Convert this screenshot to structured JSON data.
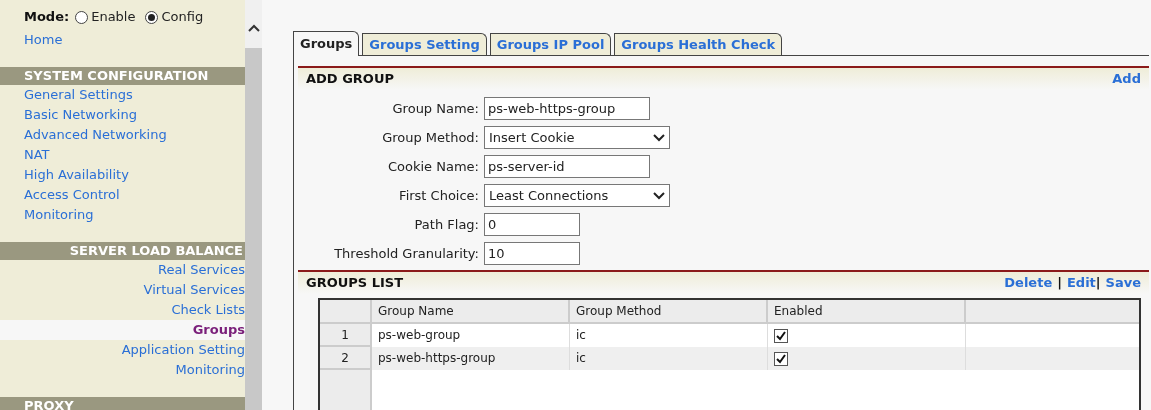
{
  "mode": {
    "label": "Mode:",
    "options": [
      {
        "label": "Enable",
        "selected": false
      },
      {
        "label": "Config",
        "selected": true
      }
    ]
  },
  "sidebar": {
    "home": "Home",
    "sections": [
      {
        "title": "SYSTEM CONFIGURATION",
        "items": [
          {
            "label": "General Settings",
            "selected": false
          },
          {
            "label": "Basic Networking",
            "selected": false
          },
          {
            "label": "Advanced Networking",
            "selected": false
          },
          {
            "label": "NAT",
            "selected": false
          },
          {
            "label": "High Availability",
            "selected": false
          },
          {
            "label": "Access Control",
            "selected": false
          },
          {
            "label": "Monitoring",
            "selected": false
          }
        ]
      },
      {
        "title": "SERVER LOAD BALANCE",
        "items": [
          {
            "label": "Real Services",
            "selected": false
          },
          {
            "label": "Virtual Services",
            "selected": false
          },
          {
            "label": "Check Lists",
            "selected": false
          },
          {
            "label": "Groups",
            "selected": true
          },
          {
            "label": "Application Setting",
            "selected": false
          },
          {
            "label": "Monitoring",
            "selected": false
          }
        ]
      },
      {
        "title": "PROXY"
      }
    ]
  },
  "tabs": [
    {
      "label": "Groups",
      "selected": true
    },
    {
      "label": "Groups Setting",
      "selected": false
    },
    {
      "label": "Groups IP Pool",
      "selected": false
    },
    {
      "label": "Groups Health Check",
      "selected": false
    }
  ],
  "add_group": {
    "title": "ADD GROUP",
    "actions": [
      "Add"
    ],
    "fields": [
      {
        "kind": "text",
        "label": "Group Name:",
        "value": "ps-web-https-group"
      },
      {
        "kind": "select",
        "label": "Group Method:",
        "value": "Insert Cookie"
      },
      {
        "kind": "text",
        "label": "Cookie Name:",
        "value": "ps-server-id"
      },
      {
        "kind": "select",
        "label": "First Choice:",
        "value": "Least Connections"
      },
      {
        "kind": "text",
        "label": "Path Flag:",
        "value": "0"
      },
      {
        "kind": "text",
        "label": "Threshold Granularity:",
        "value": "10"
      }
    ]
  },
  "groups_list": {
    "title": "GROUPS LIST",
    "actions": [
      "Delete",
      "Edit",
      "Save"
    ],
    "separator": "|",
    "columns": [
      "Group Name",
      "Group Method",
      "Enabled"
    ],
    "rows": [
      {
        "index": "1",
        "group_name": "ps-web-group",
        "group_method": "ic",
        "enabled": true
      },
      {
        "index": "2",
        "group_name": "ps-web-https-group",
        "group_method": "ic",
        "enabled": true
      }
    ]
  }
}
